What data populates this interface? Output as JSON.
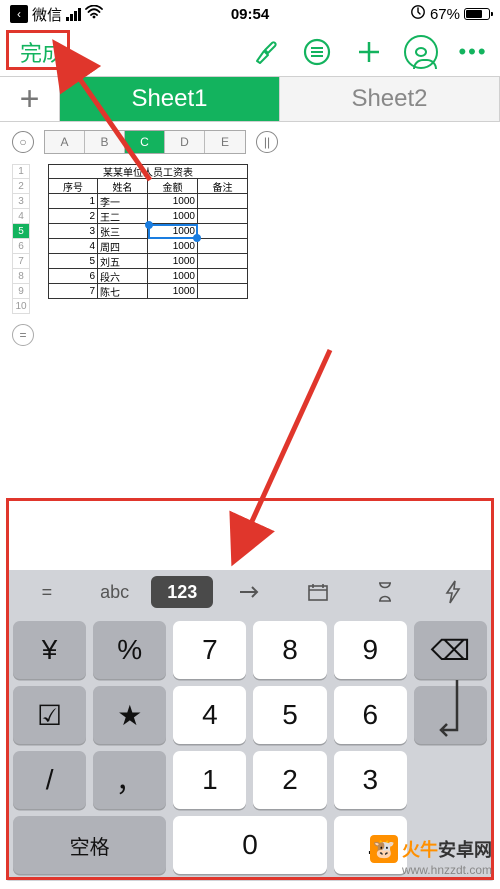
{
  "status": {
    "carrier": "微信",
    "time": "09:54",
    "battery_pct": "67%"
  },
  "header": {
    "done": "完成"
  },
  "sheets": {
    "add": "+",
    "tab1": "Sheet1",
    "tab2": "Sheet2"
  },
  "cols": {
    "a": "A",
    "b": "B",
    "c": "C",
    "d": "D",
    "e": "E"
  },
  "rownum": {
    "r1": "1",
    "r2": "2",
    "r3": "3",
    "r4": "4",
    "r5": "5",
    "r6": "6",
    "r7": "7",
    "r8": "8",
    "r9": "9",
    "r10": "10"
  },
  "table": {
    "title": "某某单位人员工资表",
    "hdr": {
      "a": "序号",
      "b": "姓名",
      "c": "金额",
      "d": "备注"
    },
    "rows": [
      {
        "a": "1",
        "b": "李一",
        "c": "1000",
        "d": ""
      },
      {
        "a": "2",
        "b": "王二",
        "c": "1000",
        "d": ""
      },
      {
        "a": "3",
        "b": "张三",
        "c": "1000",
        "d": ""
      },
      {
        "a": "4",
        "b": "周四",
        "c": "1000",
        "d": ""
      },
      {
        "a": "5",
        "b": "刘五",
        "c": "1000",
        "d": ""
      },
      {
        "a": "6",
        "b": "段六",
        "c": "1000",
        "d": ""
      },
      {
        "a": "7",
        "b": "陈七",
        "c": "1000",
        "d": ""
      }
    ]
  },
  "kb": {
    "eq": "=",
    "abc": "abc",
    "num": "123",
    "yen": "¥",
    "pct": "%",
    "k7": "7",
    "k8": "8",
    "k9": "9",
    "bsp": "⌫",
    "chk": "☑",
    "star": "★",
    "k4": "4",
    "k5": "5",
    "k6": "6",
    "slash": "/",
    "comma": "，",
    "k1": "1",
    "k2": "2",
    "k3": "3",
    "space": "空格",
    "k0": "0",
    "dot": "."
  },
  "watermark": {
    "brand_pre": "火牛",
    "brand_post": "安卓网",
    "url": "www.hnzzdt.com"
  }
}
